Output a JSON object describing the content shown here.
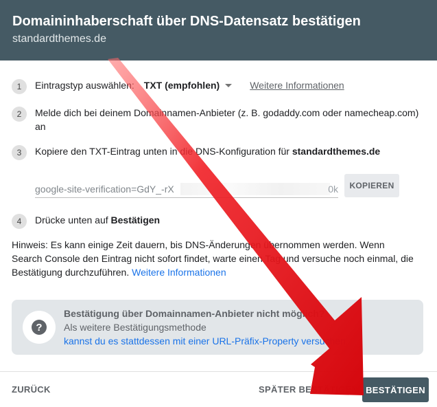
{
  "dialog": {
    "title": "Domaininhaberschaft über DNS-Datensatz bestätigen",
    "subtitle": "standardthemes.de"
  },
  "steps": {
    "s1": {
      "number": "1",
      "label": "Eintragstyp auswählen:",
      "select_value": "TXT (empfohlen)",
      "link": "Weitere Informationen"
    },
    "s2": {
      "number": "2",
      "text": "Melde dich bei deinem Domainnamen-Anbieter (z. B. godaddy.com oder namecheap.com) an"
    },
    "s3": {
      "number": "3",
      "text": "Kopiere den TXT-Eintrag unten in die DNS-Konfiguration für ",
      "domain": "standardthemes.de"
    },
    "s4": {
      "number": "4",
      "text": "Drücke unten auf ",
      "bold": "Bestätigen"
    }
  },
  "txt_record": {
    "value_visible": "google-site-verification=GdY_-rX",
    "value_tail": "0k",
    "copy_label": "KOPIEREN"
  },
  "hint": {
    "text": "Hinweis: Es kann einige Zeit dauern, bis DNS-Änderungen übernommen werden. Wenn Search Console den Eintrag nicht sofort findet, warte einen Tag und versuche noch einmal, die Bestätigung durchzuführen. ",
    "link": "Weitere Informationen"
  },
  "info_box": {
    "title": "Bestätigung über Domainnamen-Anbieter nicht möglich?",
    "line2": "Als weitere Bestätigungsmethode",
    "link": "kannst du es stattdessen mit einer URL-Präfix-Property versuchen"
  },
  "footer": {
    "back_label": "ZURÜCK",
    "later_label": "SPÄTER BESTÄTIGEN",
    "confirm_label": "BESTÄTIGEN"
  },
  "colors": {
    "header_bg": "#455a64",
    "link_blue": "#1a73e8",
    "arrow_red": "#e8141b"
  }
}
